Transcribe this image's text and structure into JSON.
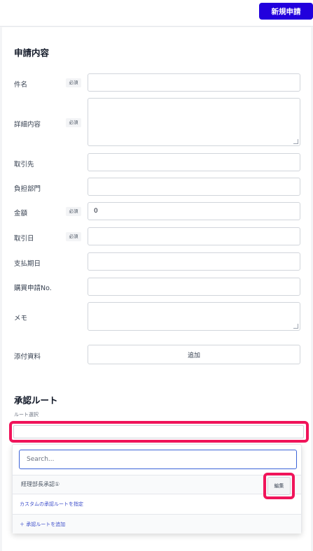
{
  "header": {
    "new_request_label": "新規申請"
  },
  "form": {
    "title": "申請内容",
    "required_label": "必須",
    "fields": [
      {
        "label": "件名",
        "required": true,
        "value": ""
      },
      {
        "label": "詳細内容",
        "required": true,
        "value": ""
      },
      {
        "label": "取引先",
        "required": false,
        "value": ""
      },
      {
        "label": "負担部門",
        "required": false,
        "value": ""
      },
      {
        "label": "金額",
        "required": true,
        "value": "0"
      },
      {
        "label": "取引日",
        "required": true,
        "value": ""
      },
      {
        "label": "支払期日",
        "required": false,
        "value": ""
      },
      {
        "label": "購買申請No.",
        "required": false,
        "value": ""
      },
      {
        "label": "メモ",
        "required": false,
        "value": ""
      },
      {
        "label": "添付資料",
        "required": false,
        "value": ""
      }
    ],
    "attach_button_label": "追加"
  },
  "approval": {
    "title": "承認ルート",
    "route_select_label": "ルート選択",
    "route_select_value": "",
    "dropdown": {
      "search_placeholder": "Search...",
      "options": [
        {
          "label": "経理部長承認①",
          "edit_label": "編集"
        }
      ],
      "custom_route_label": "カスタムの承認ルートを指定",
      "add_route_label": "＋ 承認ルートを追加"
    }
  },
  "colors": {
    "primary": "#2200dd",
    "highlight": "#f0145a",
    "link": "#3b4cca"
  }
}
